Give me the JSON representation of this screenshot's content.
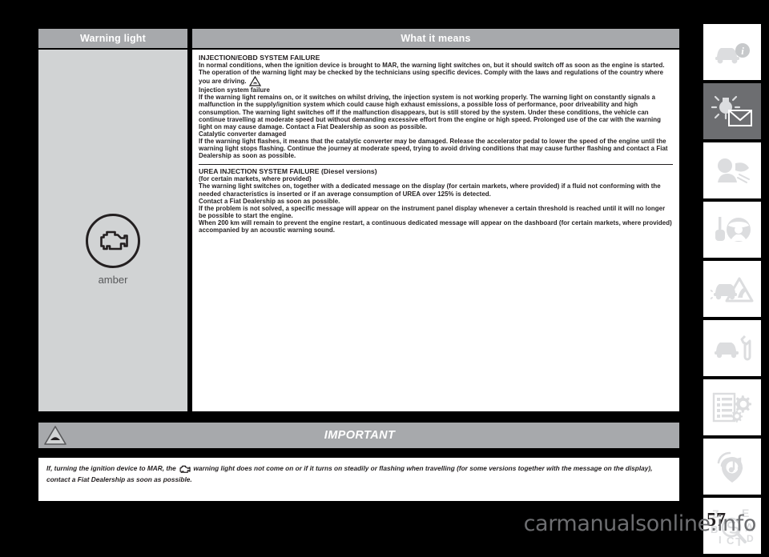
{
  "table": {
    "header_warning_light": "Warning light",
    "header_what_it_means": "What it means",
    "lamp_colour_label": "amber"
  },
  "sections": [
    {
      "title": "INJECTION/EOBD SYSTEM FAILURE",
      "paragraphs": [
        "In normal conditions, when the ignition device is brought to MAR, the warning light switches on, but it should switch off as soon as the engine is started. The operation of the warning light may be checked by the technicians using specific devices. Comply with the laws and regulations of the country where you are driving."
      ],
      "subsections": [
        {
          "heading": "Injection system failure",
          "text": "If the warning light remains on, or it switches on whilst driving, the injection system is not working properly. The warning light on constantly signals a malfunction in the supply/ignition system which could cause high exhaust emissions, a possible loss of performance, poor driveability and high consumption. The warning light switches off if the malfunction disappears, but is still stored by the system. Under these conditions, the vehicle can continue travelling at moderate speed but without demanding excessive effort from the engine or high speed. Prolonged use of the car with the warning light on may cause damage. Contact a Fiat Dealership as soon as possible."
        },
        {
          "heading": "Catalytic converter damaged",
          "text": "If the warning light flashes, it means that the catalytic converter may be damaged. Release the accelerator pedal to lower the speed of the engine until the warning light stops flashing. Continue the journey at moderate speed, trying to avoid driving conditions that may cause further flashing and contact a Fiat Dealership as soon as possible."
        }
      ]
    },
    {
      "title": "UREA INJECTION SYSTEM FAILURE (Diesel versions)",
      "subtitle": "(for certain markets, where provided)",
      "paragraphs": [
        "The warning light switches on, together with a dedicated message on the display (for certain markets, where provided) if a fluid not conforming with the needed characteristics is inserted or if an average consumption of UREA over 125% is detected.",
        "Contact a Fiat Dealership as soon as possible.",
        "If the problem is not solved, a specific message will appear on the instrument panel display whenever a certain threshold is reached until it will no longer be possible to start the engine.",
        "When 200 km will remain to prevent the engine restart, a continuous dedicated message will appear on the dashboard (for certain markets, where provided) accompanied by an acoustic warning sound."
      ]
    }
  ],
  "important": {
    "label": "IMPORTANT",
    "icon": "warning-triangle-icon"
  },
  "note": {
    "text_before_icon": "If, turning the ignition device to MAR, the",
    "text_after_icon": "warning light does not come on or if it turns on steadily or flashing when travelling (for some versions together with the message on the display), contact a Fiat Dealership as soon as possible.",
    "icon": "engine-check-icon"
  },
  "sidebar": {
    "items": [
      {
        "icon": "car-info-icon",
        "active": false
      },
      {
        "icon": "lights-and-message-icon",
        "active": true
      },
      {
        "icon": "airbag-icon",
        "active": false
      },
      {
        "icon": "key-steering-wheel-icon",
        "active": false
      },
      {
        "icon": "emergency-warning-triangle-icon",
        "active": false
      },
      {
        "icon": "car-service-wrench-icon",
        "active": false
      },
      {
        "icon": "technical-specs-gears-icon",
        "active": false
      },
      {
        "icon": "multimedia-music-icon",
        "active": false
      },
      {
        "icon": "alphabetical-index-icon",
        "active": false
      }
    ]
  },
  "footer": {
    "page_number": "57",
    "watermark": "carmanualsonline.info"
  },
  "colors": {
    "header_gray": "#a7a9ac",
    "left_cell_gray": "#d1d3d4",
    "text_dark": "#231f20",
    "sidebar_active": "#6d6e71",
    "icon_light": "#dcdddf"
  }
}
